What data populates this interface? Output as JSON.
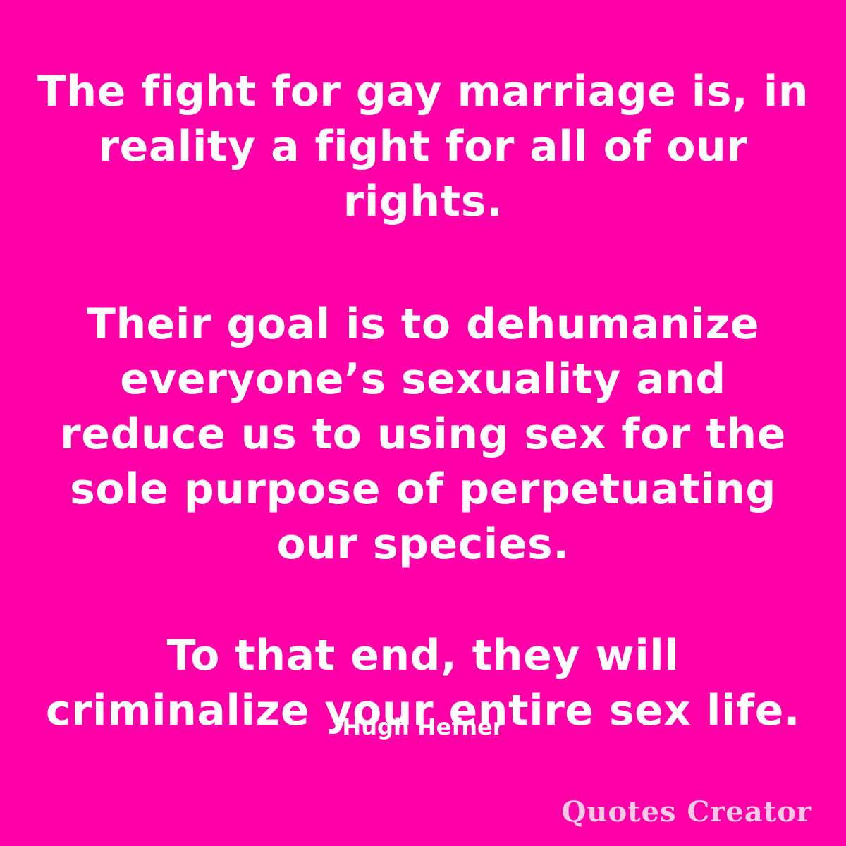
{
  "quote": {
    "lines": [
      "The fight for gay marriage is, in",
      "reality a fight for all of our",
      "rights.",
      "Their goal is to dehumanize",
      "everyone’s sexuality and",
      "reduce us to using sex for the",
      "sole purpose of perpetuating",
      "our species.",
      "To that end, they will",
      "criminalize your entire sex life."
    ]
  },
  "author": "Hugh Hefner",
  "watermark": "Quotes Creator",
  "colors": {
    "background": "#ff00a8",
    "text": "#ffffff",
    "watermark": "#f7c9e2"
  }
}
